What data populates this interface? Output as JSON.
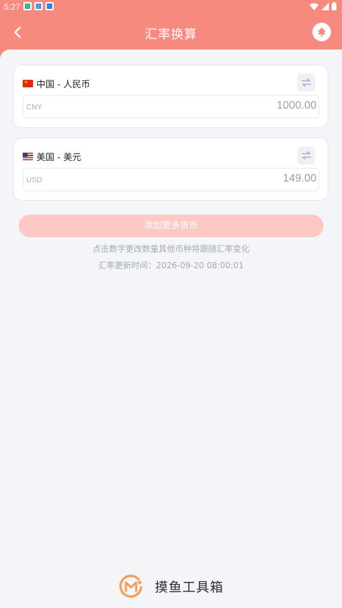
{
  "status_bar": {
    "time": "5:27"
  },
  "header": {
    "title": "汇率换算",
    "icons": {
      "back": "back-chevron-icon",
      "share": "share-icon"
    }
  },
  "currencies": [
    {
      "flag": "china-flag-icon",
      "name": "中国 - 人民币",
      "code": "CNY",
      "amount": "1000.00"
    },
    {
      "flag": "usa-flag-icon",
      "name": "美国 - 美元",
      "code": "USD",
      "amount": "149.00"
    }
  ],
  "add_button": "添加更多货币",
  "hint": "点击数字更改数量其他币种将跟随汇率变化",
  "update_time": "汇率更新时间：2026-09-20 08:00:01",
  "footer": {
    "brand": "摸鱼工具箱"
  },
  "colors": {
    "header": "#f68a7e",
    "add_button": "#fec9c4",
    "background": "#f4f5f8",
    "logo": "#f3a15f"
  }
}
